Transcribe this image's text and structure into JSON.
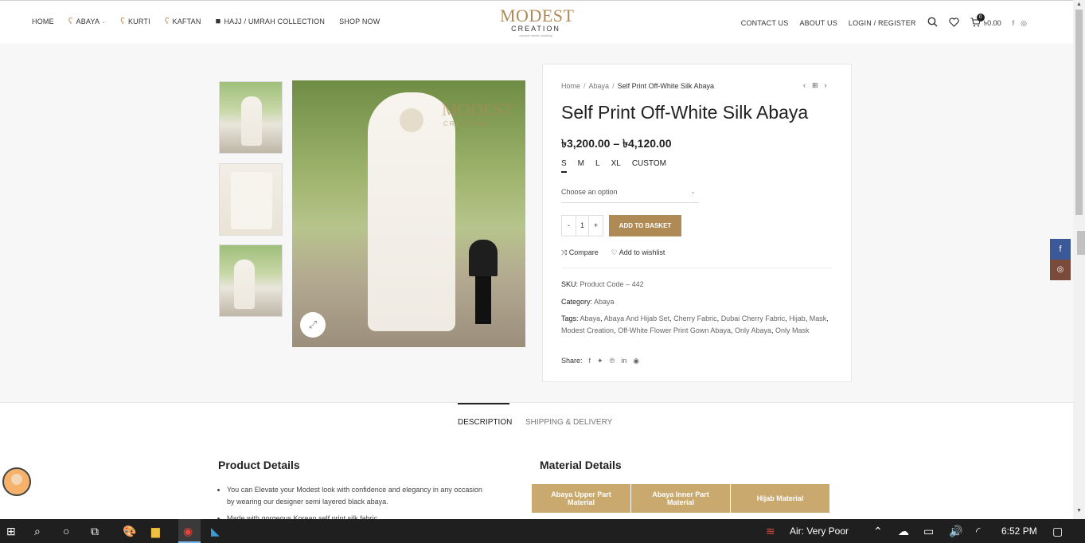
{
  "header": {
    "nav_left": [
      {
        "label": "HOME",
        "icon": ""
      },
      {
        "label": "ABAYA",
        "icon": "hanger-icon",
        "caret": true
      },
      {
        "label": "KURTI",
        "icon": "hanger-icon"
      },
      {
        "label": "KAFTAN",
        "icon": "hanger-icon"
      },
      {
        "label": "HAJJ / UMRAH COLLECTION",
        "icon": "kaaba-icon"
      },
      {
        "label": "SHOP NOW",
        "icon": ""
      }
    ],
    "logo": {
      "line1": "MODEST",
      "line2": "CREATION",
      "line3": "comfort meets modesty"
    },
    "nav_right": [
      "CONTACT US",
      "ABOUT US",
      "LOGIN / REGISTER"
    ],
    "cart_count": "0",
    "cart_total": "৳0.00"
  },
  "gallery": {
    "watermark_line1": "MODEST",
    "watermark_line2": "CREATION"
  },
  "product": {
    "breadcrumb": [
      "Home",
      "Abaya",
      "Self Print Off-White Silk Abaya"
    ],
    "title": "Self Print Off-White Silk Abaya",
    "price": "৳3,200.00 – ৳4,120.00",
    "sizes": [
      "S",
      "M",
      "L",
      "XL",
      "CUSTOM"
    ],
    "select_placeholder": "Choose an option",
    "qty_minus": "-",
    "qty_value": "1",
    "qty_plus": "+",
    "add_to_basket": "ADD TO BASKET",
    "compare": "Compare",
    "wishlist": "Add to wishlist",
    "sku_label": "SKU:",
    "sku_value": "Product Code – 442",
    "category_label": "Category:",
    "category_value": "Abaya",
    "tags_label": "Tags:",
    "tags": [
      "Abaya",
      "Abaya And Hijab Set",
      "Cherry Fabric",
      "Dubai Cherry Fabric",
      "Hijab",
      "Mask",
      "Modest Creation",
      "Off-White Flower Print Gown Abaya",
      "Only Abaya",
      "Only Mask"
    ],
    "share_label": "Share:"
  },
  "tabs": [
    "DESCRIPTION",
    "SHIPPING & DELIVERY"
  ],
  "details": {
    "product_heading": "Product Details",
    "material_heading": "Material Details",
    "bullets": [
      "You can Elevate your Modest look with confidence and elegancy in any occasion by wearing our designer semi layered black abaya.",
      "Made with gorgeous Korean self print silk fabric"
    ],
    "table_headers": [
      "Abaya Upper Part Material",
      "Abaya Inner Part Material",
      "Hijab Material"
    ]
  },
  "taskbar": {
    "air_quality": "Air: Very Poor",
    "time": "6:52 PM"
  },
  "colors": {
    "accent": "#b08a55",
    "table_header": "#c9a96e",
    "facebook": "#3b5998"
  }
}
